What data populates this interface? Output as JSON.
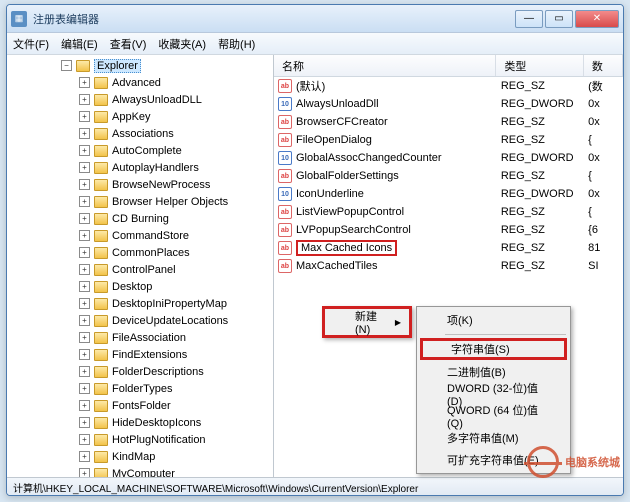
{
  "window": {
    "title": "注册表编辑器"
  },
  "menubar": [
    "文件(F)",
    "编辑(E)",
    "查看(V)",
    "收藏夹(A)",
    "帮助(H)"
  ],
  "tree": {
    "root": "Explorer",
    "items": [
      "Advanced",
      "AlwaysUnloadDLL",
      "AppKey",
      "Associations",
      "AutoComplete",
      "AutoplayHandlers",
      "BrowseNewProcess",
      "Browser Helper Objects",
      "CD Burning",
      "CommandStore",
      "CommonPlaces",
      "ControlPanel",
      "Desktop",
      "DesktopIniPropertyMap",
      "DeviceUpdateLocations",
      "FileAssociation",
      "FindExtensions",
      "FolderDescriptions",
      "FolderTypes",
      "FontsFolder",
      "HideDesktopIcons",
      "HotPlugNotification",
      "KindMap",
      "MyComputer"
    ]
  },
  "list": {
    "headers": {
      "name": "名称",
      "type": "类型",
      "data": "数"
    },
    "rows": [
      {
        "ic": "sz",
        "name": "(默认)",
        "type": "REG_SZ",
        "data": "(数"
      },
      {
        "ic": "dw",
        "name": "AlwaysUnloadDll",
        "type": "REG_DWORD",
        "data": "0x"
      },
      {
        "ic": "sz",
        "name": "BrowserCFCreator",
        "type": "REG_SZ",
        "data": "0x"
      },
      {
        "ic": "sz",
        "name": "FileOpenDialog",
        "type": "REG_SZ",
        "data": "{"
      },
      {
        "ic": "dw",
        "name": "GlobalAssocChangedCounter",
        "type": "REG_DWORD",
        "data": "0x"
      },
      {
        "ic": "sz",
        "name": "GlobalFolderSettings",
        "type": "REG_SZ",
        "data": "{"
      },
      {
        "ic": "dw",
        "name": "IconUnderline",
        "type": "REG_DWORD",
        "data": "0x"
      },
      {
        "ic": "sz",
        "name": "ListViewPopupControl",
        "type": "REG_SZ",
        "data": "{"
      },
      {
        "ic": "sz",
        "name": "LVPopupSearchControl",
        "type": "REG_SZ",
        "data": "{6"
      },
      {
        "ic": "sz",
        "name": "Max Cached Icons",
        "type": "REG_SZ",
        "data": "81",
        "hl": true
      },
      {
        "ic": "sz",
        "name": "MaxCachedTiles",
        "type": "REG_SZ",
        "data": "SI"
      }
    ]
  },
  "ctx1": {
    "new": "新建(N)"
  },
  "ctx2": {
    "key": "项(K)",
    "string": "字符串值(S)",
    "binary": "二进制值(B)",
    "dword": "DWORD (32-位)值(D)",
    "qword": "QWORD (64 位)值(Q)",
    "multi": "多字符串值(M)",
    "expand": "可扩充字符串值(E)"
  },
  "statusbar": "计算机\\HKEY_LOCAL_MACHINE\\SOFTWARE\\Microsoft\\Windows\\CurrentVersion\\Explorer",
  "watermark": "电脑系统城"
}
